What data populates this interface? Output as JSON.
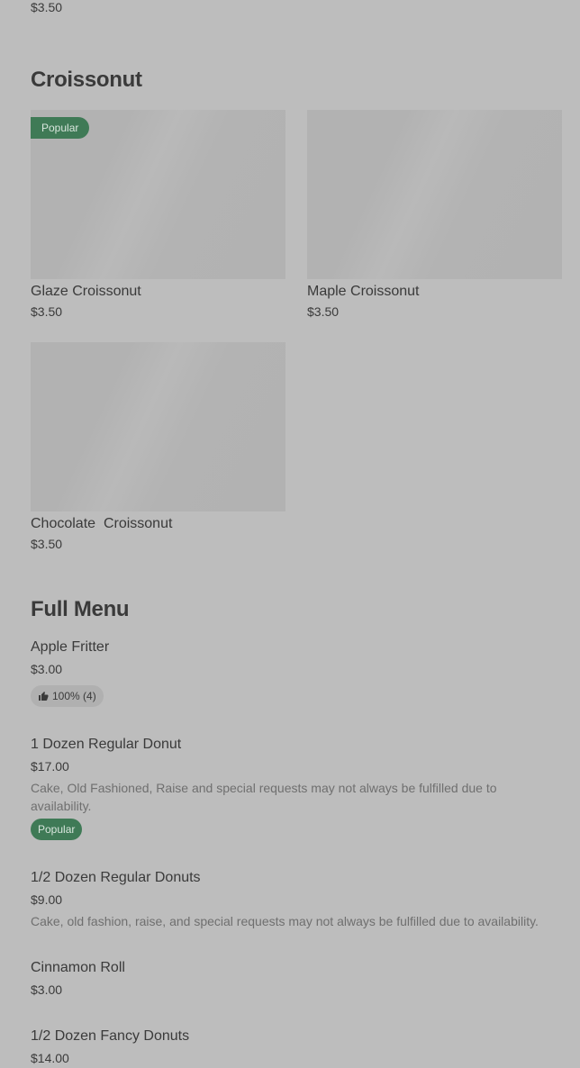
{
  "top_price": "$3.50",
  "croissonut": {
    "title": "Croissonut",
    "items": [
      {
        "name": "Glaze Croissonut",
        "price": "$3.50",
        "badge": "Popular"
      },
      {
        "name": "Maple Croissonut",
        "price": "$3.50"
      },
      {
        "name": "Chocolate  Croissonut",
        "price": "$3.50"
      }
    ]
  },
  "full_menu": {
    "title": "Full Menu",
    "items": [
      {
        "name": "Apple Fritter",
        "price": "$3.00",
        "rating": "100% (4)"
      },
      {
        "name": "1 Dozen Regular Donut",
        "price": "$17.00",
        "description": "Cake, Old Fashioned, Raise and special requests may not always be fulfilled due to availability.",
        "badge": "Popular"
      },
      {
        "name": "1/2 Dozen Regular Donuts",
        "price": "$9.00",
        "description": "Cake, old fashion, raise, and special requests may not always be fulfilled due to availability."
      },
      {
        "name": "Cinnamon Roll",
        "price": "$3.00"
      },
      {
        "name": "1/2 Dozen Fancy Donuts",
        "price": "$14.00"
      }
    ]
  },
  "colors": {
    "background": "#bdbdbd",
    "popular_badge": "#3f7a56",
    "text": "#3a3a3a",
    "muted_text": "#6f6f6f"
  },
  "icons": {
    "rating": "thumbs-up-icon"
  }
}
